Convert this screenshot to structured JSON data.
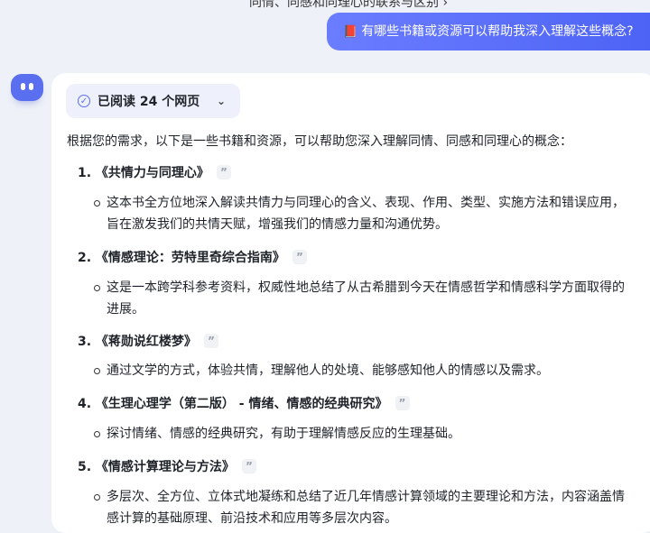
{
  "top_text": "同情、同感和同理心的联系与区别 ›",
  "user_message": "有哪些书籍或资源可以帮助我深入理解这些概念?",
  "read_pill": {
    "label": "已阅读 24 个网页"
  },
  "intro": "根据您的需求，以下是一些书籍和资源，可以帮助您深入理解同情、同感和同理心的概念：",
  "items": [
    {
      "title": "1. 《共情力与同理心》",
      "desc": "这本书全方位地深入解读共情力与同理心的含义、表现、作用、类型、实施方法和错误应用，旨在激发我们的共情天赋，增强我们的情感力量和沟通优势。"
    },
    {
      "title": "2. 《情感理论：劳特里奇综合指南》",
      "desc": "这是一本跨学科参考资料，权威性地总结了从古希腊到今天在情感哲学和情感科学方面取得的进展。"
    },
    {
      "title": "3. 《蒋勋说红楼梦》",
      "desc": "通过文学的方式，体验共情，理解他人的处境、能够感知他人的情感以及需求。"
    },
    {
      "title": "4. 《生理心理学（第二版） - 情绪、情感的经典研究》",
      "desc": "探讨情绪、情感的经典研究，有助于理解情感反应的生理基础。"
    },
    {
      "title": "5. 《情感计算理论与方法》",
      "desc": "多层次、全方位、立体式地凝练和总结了近几年情感计算领域的主要理论和方法，内容涵盖情感计算的基础原理、前沿技术和应用等多层次内容。"
    }
  ],
  "colors": {
    "accent": "#5a6ff0",
    "bubble": "#4d63f5",
    "background": "#eef1f8"
  }
}
